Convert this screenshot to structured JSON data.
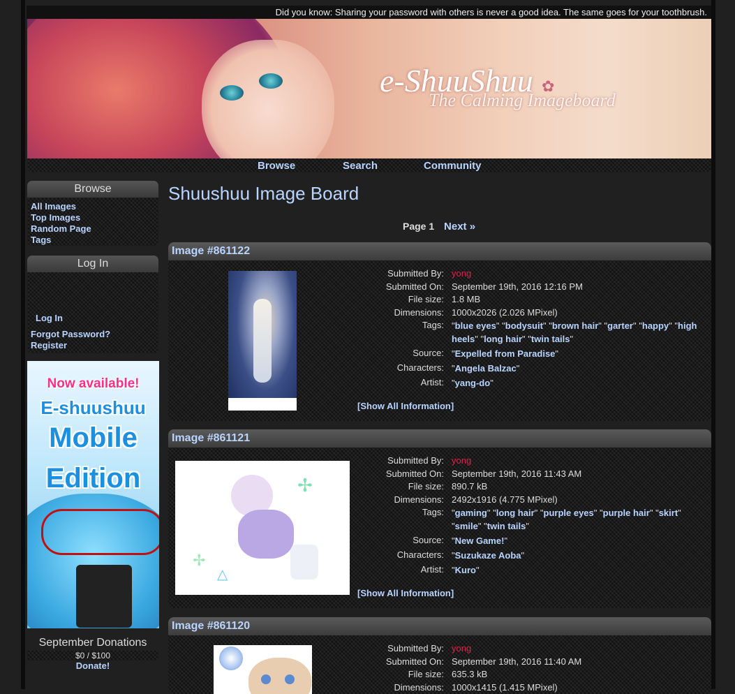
{
  "tip": "Did you know: Sharing your password with others is never a good idea. The same goes for your toothbrush.",
  "banner": {
    "logo": "e-ShuuShuu",
    "tagline": "The Calming Imageboard"
  },
  "nav": {
    "browse": "Browse",
    "search": "Search",
    "community": "Community"
  },
  "sidebar": {
    "browse": {
      "title": "Browse",
      "links": [
        "All Images",
        "Top Images",
        "Random Page",
        "Tags"
      ]
    },
    "login": {
      "title": "Log In",
      "login_link": "Log In",
      "forgot": "Forgot Password?",
      "register": "Register"
    },
    "promo": {
      "line1": "Now available!",
      "line2": "E-shuushuu",
      "line3": "Mobile",
      "line4": "Edition"
    },
    "donations": {
      "title": "September Donations",
      "amount": "$0 / $100",
      "link": "Donate!"
    }
  },
  "page": {
    "title": "Shuushuu Image Board",
    "pager": {
      "current": "Page 1",
      "next": "Next »"
    }
  },
  "labels": {
    "submitted_by": "Submitted By:",
    "submitted_on": "Submitted On:",
    "file_size": "File size:",
    "dimensions": "Dimensions:",
    "tags": "Tags:",
    "source": "Source:",
    "characters": "Characters:",
    "artist": "Artist:",
    "show_all": "[Show All Information]"
  },
  "posts": [
    {
      "title": "Image #861122",
      "user": "yong",
      "date": "September 19th, 2016 12:16 PM",
      "size": "1.8 MB",
      "dims": "1000x2026 (2.026 MPixel)",
      "tags": [
        "blue eyes",
        "bodysuit",
        "brown hair",
        "garter",
        "happy",
        "high heels",
        "long hair",
        "twin tails"
      ],
      "source": "Expelled from Paradise",
      "characters": "Angela Balzac",
      "artist": "yang-do"
    },
    {
      "title": "Image #861121",
      "user": "yong",
      "date": "September 19th, 2016 11:43 AM",
      "size": "890.7 kB",
      "dims": "2492x1916 (4.775 MPixel)",
      "tags": [
        "gaming",
        "long hair",
        "purple eyes",
        "purple hair",
        "skirt",
        "smile",
        "twin tails"
      ],
      "source": "New Game!",
      "characters": "Suzukaze Aoba",
      "artist": "Kuro"
    },
    {
      "title": "Image #861120",
      "user": "yong",
      "date": "September 19th, 2016 11:40 AM",
      "size": "635.3 kB",
      "dims": "1000x1415 (1.415 MPixel)"
    }
  ]
}
